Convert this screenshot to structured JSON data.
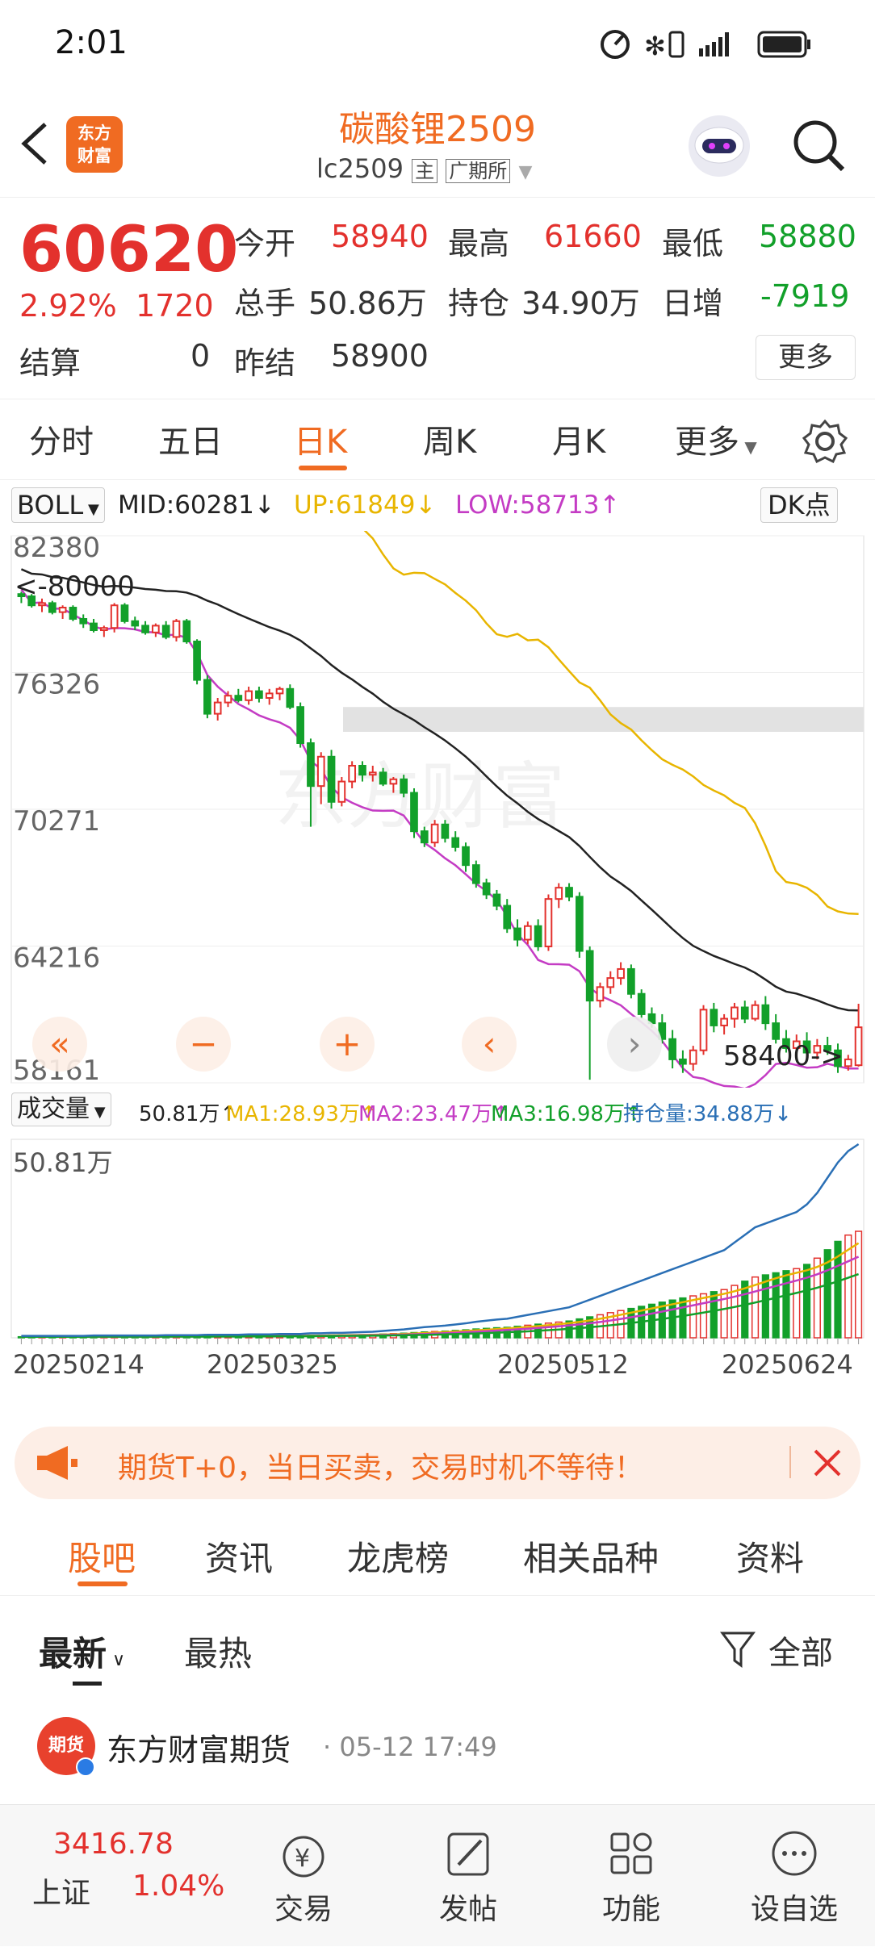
{
  "statusbar": {
    "time": "2:01"
  },
  "header": {
    "title": "碳酸锂2509",
    "code": "lc2509",
    "tag_main": "主",
    "exchange": "广期所",
    "logo_line1": "东方",
    "logo_line2": "财富"
  },
  "quote": {
    "price": "60620",
    "pct": "2.92%",
    "change": "1720",
    "open_label": "今开",
    "open": "58940",
    "high_label": "最高",
    "high": "61660",
    "low_label": "最低",
    "low": "58880",
    "volume_label": "总手",
    "volume": "50.86万",
    "oi_label": "持仓",
    "oi": "34.90万",
    "daily_inc_label": "日增",
    "daily_inc": "-7919",
    "settle_label": "结算",
    "settle": "0",
    "prev_settle_label": "昨结",
    "prev_settle": "58900",
    "more": "更多"
  },
  "tabs": [
    "分时",
    "五日",
    "日K",
    "周K",
    "月K",
    "更多"
  ],
  "indicator": {
    "name": "BOLL",
    "mid": "MID:60281↓",
    "up": "UP:61849↓",
    "low": "LOW:58713↑",
    "dk": "DK点"
  },
  "chart_data": {
    "type": "candlestick",
    "y_axis_labels": [
      "82380",
      "76326",
      "70271",
      "64216",
      "58161"
    ],
    "ylim": [
      58161,
      82380
    ],
    "annotations": [
      "<-80000",
      "58400->"
    ],
    "candles": [
      [
        79800,
        79900,
        79400,
        79700
      ],
      [
        79700,
        79800,
        79200,
        79300
      ],
      [
        79300,
        79600,
        79000,
        79400
      ],
      [
        79400,
        79500,
        78900,
        79000
      ],
      [
        79000,
        79300,
        78700,
        79200
      ],
      [
        79200,
        79300,
        78600,
        78700
      ],
      [
        78700,
        78900,
        78300,
        78500
      ],
      [
        78500,
        78700,
        78100,
        78200
      ],
      [
        78200,
        78400,
        77900,
        78300
      ],
      [
        78300,
        79400,
        78100,
        79300
      ],
      [
        79300,
        79400,
        78500,
        78600
      ],
      [
        78600,
        78800,
        78200,
        78400
      ],
      [
        78400,
        78600,
        78000,
        78100
      ],
      [
        78100,
        78500,
        77900,
        78400
      ],
      [
        78400,
        78600,
        77800,
        77900
      ],
      [
        77900,
        78700,
        77700,
        78600
      ],
      [
        78600,
        78700,
        77600,
        77700
      ],
      [
        77700,
        77800,
        75800,
        76000
      ],
      [
        76000,
        76200,
        74300,
        74500
      ],
      [
        74500,
        75200,
        74200,
        75000
      ],
      [
        75000,
        75500,
        74800,
        75300
      ],
      [
        75300,
        75600,
        75000,
        75100
      ],
      [
        75100,
        75700,
        74900,
        75500
      ],
      [
        75500,
        75700,
        75000,
        75200
      ],
      [
        75200,
        75600,
        74900,
        75400
      ],
      [
        75400,
        75700,
        75100,
        75600
      ],
      [
        75600,
        75800,
        74700,
        74800
      ],
      [
        74800,
        75000,
        73000,
        73200
      ],
      [
        73200,
        73400,
        69500,
        71300
      ],
      [
        71300,
        72800,
        70500,
        72600
      ],
      [
        72600,
        72900,
        70300,
        70600
      ],
      [
        70600,
        71700,
        70400,
        71500
      ],
      [
        71500,
        72400,
        71200,
        72200
      ],
      [
        72200,
        72400,
        71500,
        71800
      ],
      [
        71800,
        72200,
        71500,
        71900
      ],
      [
        71900,
        72100,
        71300,
        71400
      ],
      [
        71400,
        71700,
        71000,
        71600
      ],
      [
        71600,
        71800,
        70800,
        71000
      ],
      [
        71000,
        71200,
        69000,
        69300
      ],
      [
        69300,
        69500,
        68600,
        68800
      ],
      [
        68800,
        69800,
        68600,
        69600
      ],
      [
        69600,
        69800,
        68800,
        69000
      ],
      [
        69000,
        69300,
        68400,
        68600
      ],
      [
        68600,
        68800,
        67500,
        67800
      ],
      [
        67800,
        68000,
        66800,
        67000
      ],
      [
        67000,
        67200,
        66300,
        66500
      ],
      [
        66500,
        66700,
        65800,
        66000
      ],
      [
        66000,
        66300,
        64800,
        65000
      ],
      [
        65000,
        65400,
        64200,
        64500
      ],
      [
        64500,
        65300,
        64300,
        65100
      ],
      [
        65100,
        65400,
        64000,
        64200
      ],
      [
        64200,
        66500,
        64000,
        66300
      ],
      [
        66300,
        67000,
        65900,
        66800
      ],
      [
        66800,
        67000,
        66200,
        66400
      ],
      [
        66400,
        66600,
        63700,
        64000
      ],
      [
        64000,
        64200,
        58300,
        61800
      ],
      [
        61800,
        62600,
        61500,
        62400
      ],
      [
        62400,
        63100,
        62100,
        62800
      ],
      [
        62800,
        63500,
        62500,
        63200
      ],
      [
        63200,
        63400,
        61900,
        62100
      ],
      [
        62100,
        62300,
        61000,
        61200
      ],
      [
        61200,
        61500,
        60600,
        60800
      ],
      [
        60800,
        61200,
        59900,
        60100
      ],
      [
        60100,
        60500,
        58800,
        59200
      ],
      [
        59200,
        59600,
        58600,
        59000
      ],
      [
        59000,
        59800,
        58700,
        59600
      ],
      [
        59600,
        61600,
        59400,
        61400
      ],
      [
        61400,
        61700,
        60400,
        60700
      ],
      [
        60700,
        61200,
        60300,
        61000
      ],
      [
        61000,
        61700,
        60600,
        61500
      ],
      [
        61500,
        61800,
        60800,
        61000
      ],
      [
        61000,
        61800,
        60900,
        61600
      ],
      [
        61600,
        62000,
        60500,
        60800
      ],
      [
        60800,
        61200,
        59900,
        60100
      ],
      [
        60100,
        60500,
        59500,
        59700
      ],
      [
        59700,
        60300,
        59400,
        60000
      ],
      [
        60000,
        60400,
        59300,
        59500
      ],
      [
        59500,
        60100,
        59200,
        59800
      ],
      [
        59800,
        60200,
        59400,
        59600
      ],
      [
        59600,
        59900,
        58600,
        58900
      ],
      [
        58900,
        59400,
        58700,
        59200
      ],
      [
        58940,
        61660,
        58880,
        60620
      ]
    ],
    "boll_up_label": "UP",
    "boll_mid_label": "MID",
    "boll_low_label": "LOW",
    "volume_panel": {
      "label": "成交量",
      "value": "50.81万↑",
      "ma1": "MA1:28.93万↑",
      "ma2": "MA2:23.47万↑",
      "ma3": "MA3:16.98万↑",
      "oi": "持仓量:34.88万↓",
      "max_label": "50.81万",
      "x_labels": [
        "20250214",
        "20250325",
        "20250512",
        "20250624"
      ],
      "volumes": [
        0.5,
        0.5,
        0.5,
        0.5,
        0.5,
        0.5,
        0.5,
        0.6,
        0.6,
        0.6,
        0.6,
        0.6,
        0.6,
        0.6,
        0.7,
        0.7,
        0.7,
        0.7,
        0.8,
        0.8,
        0.8,
        0.8,
        0.9,
        0.9,
        0.9,
        1.0,
        1.0,
        1.0,
        1.2,
        1.2,
        1.3,
        1.3,
        1.4,
        1.5,
        1.6,
        1.8,
        2.0,
        2.2,
        2.5,
        2.8,
        3.0,
        3.2,
        3.5,
        3.8,
        4.2,
        4.5,
        4.8,
        5.0,
        5.5,
        6.0,
        6.5,
        7.0,
        7.5,
        8.0,
        9.0,
        10.0,
        11.0,
        12.0,
        13.0,
        14.0,
        15.0,
        16.0,
        17.0,
        18.0,
        19.0,
        20.0,
        21.0,
        22.0,
        23.0,
        25.0,
        27.0,
        29.0,
        30.0,
        31.0,
        32.0,
        33.0,
        35.0,
        38.0,
        42.0,
        46.0,
        49.0,
        50.81
      ]
    }
  },
  "banner": {
    "text": "期货T+0，当日买卖，交易时机不等待！"
  },
  "content_tabs": [
    "股吧",
    "资讯",
    "龙虎榜",
    "相关品种",
    "资料"
  ],
  "filter": {
    "latest": "最新",
    "hot": "最热",
    "all": "全部"
  },
  "post": {
    "author": "东方财富期货",
    "time": "05-12 17:49",
    "avatar_text": "期货"
  },
  "bottom_nav": {
    "index_value": "3416.78",
    "index_name": "上证",
    "index_pct": "1.04%",
    "trade": "交易",
    "post": "发帖",
    "func": "功能",
    "watch": "设自选"
  }
}
